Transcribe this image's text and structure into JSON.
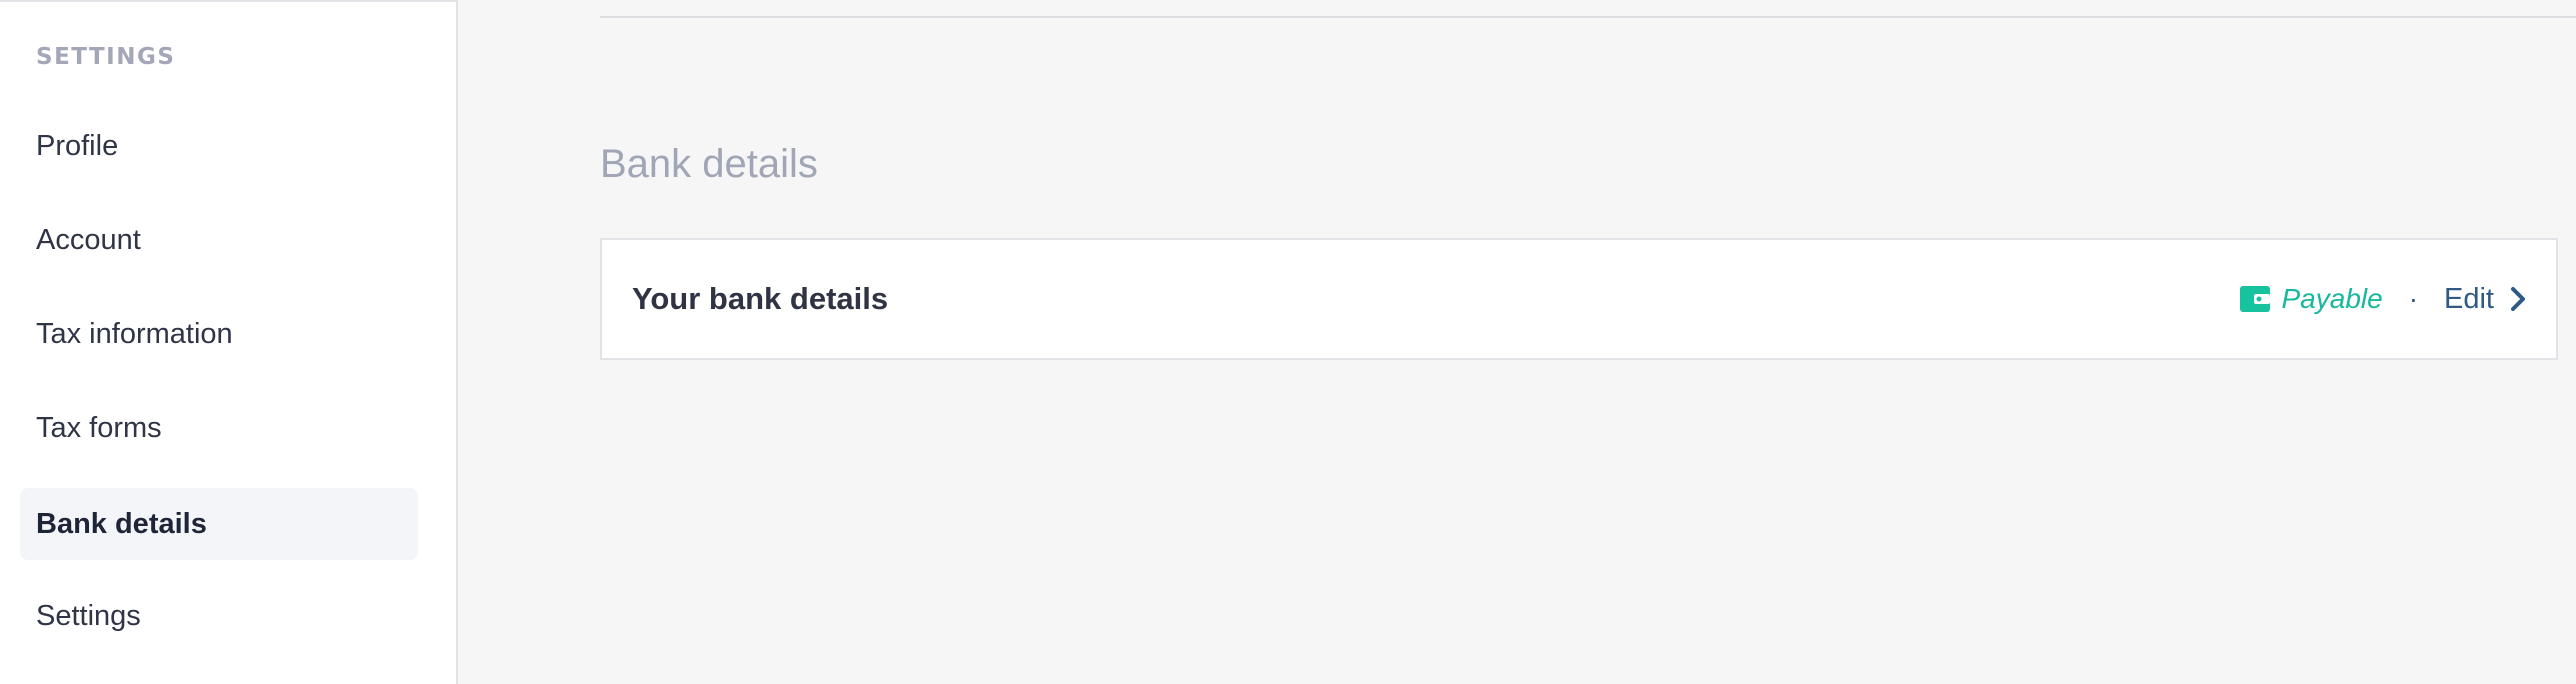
{
  "sidebar": {
    "heading": "SETTINGS",
    "items": [
      {
        "label": "Profile",
        "active": false
      },
      {
        "label": "Account",
        "active": false
      },
      {
        "label": "Tax information",
        "active": false
      },
      {
        "label": "Tax forms",
        "active": false
      },
      {
        "label": "Bank details",
        "active": true
      },
      {
        "label": "Settings",
        "active": false
      }
    ]
  },
  "main": {
    "section_title": "Bank details",
    "card": {
      "title": "Your bank details",
      "status_icon": "wallet-icon",
      "status_label": "Payable",
      "separator": "·",
      "edit_label": "Edit",
      "edit_icon": "chevron-right-icon"
    }
  },
  "colors": {
    "accent_green": "#17b89c",
    "link_blue": "#2f5a86",
    "muted_gray": "#a1a6b6"
  }
}
